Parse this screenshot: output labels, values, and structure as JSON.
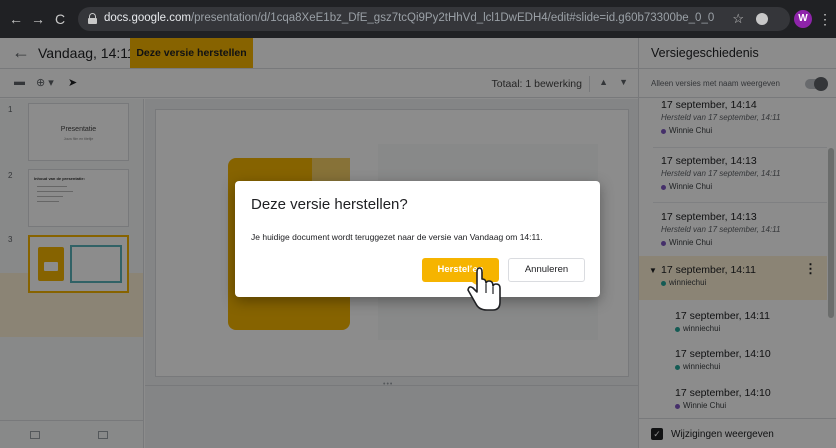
{
  "browser": {
    "url_host": "docs.google.com",
    "url_path": "/presentation/d/1cqa8XeE1bz_DfE_gsz7tcQi9Py2tHhVd_lcl1DwEDH4/edit#slide=id.g60b73300be_0_0",
    "profile_initial": "W"
  },
  "header": {
    "title": "Vandaag, 14:11",
    "restore_button": "Deze versie herstellen"
  },
  "toolbar": {
    "total_edits": "Totaal: 1 bewerking"
  },
  "filmstrip": {
    "slides": [
      {
        "number": "1",
        "title": "Presentatie",
        "subtitle": "Jouw film en titeltje"
      },
      {
        "number": "2",
        "heading": "Inhoud van de presentatie:"
      },
      {
        "number": "3"
      }
    ]
  },
  "version_panel": {
    "title": "Versiegeschiedenis",
    "named_only_label": "Alleen versies met naam weergeven",
    "show_changes_label": "Wijzigingen weergeven",
    "versions": [
      {
        "date": "17 september, 14:14",
        "restored": "Hersteld van 17 september, 14:11",
        "user": "Winnie Chui",
        "color": "#7e57c2"
      },
      {
        "date": "17 september, 14:13",
        "restored": "Hersteld van 17 september, 14:11",
        "user": "Winnie Chui",
        "color": "#7e57c2"
      },
      {
        "date": "17 september, 14:13",
        "restored": "Hersteld van 17 september, 14:11",
        "user": "Winnie Chui",
        "color": "#7e57c2"
      },
      {
        "date": "17 september, 14:11",
        "user": "winniechui",
        "color": "#26a69a"
      },
      {
        "date": "17 september, 14:11",
        "user": "winniechui",
        "color": "#26a69a"
      },
      {
        "date": "17 september, 14:10",
        "user": "winniechui",
        "color": "#26a69a"
      },
      {
        "date": "17 september, 14:10",
        "user": "Winnie Chui",
        "color": "#7e57c2"
      }
    ]
  },
  "dialog": {
    "title": "Deze versie herstellen?",
    "message": "Je huidige document wordt teruggezet naar de versie van Vandaag om 14:11.",
    "confirm": "Herstellen",
    "cancel": "Annuleren"
  },
  "colors": {
    "accent": "#f6b400",
    "selection": "#fdf0d5"
  }
}
